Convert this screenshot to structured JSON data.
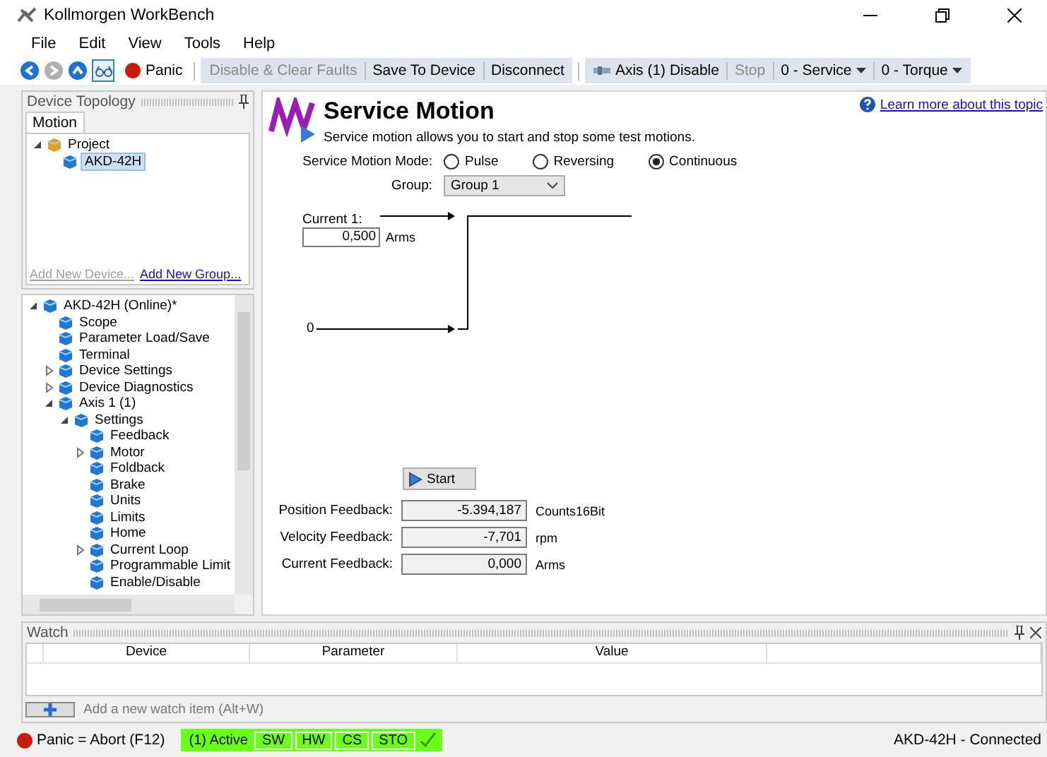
{
  "window": {
    "title": "Kollmorgen WorkBench"
  },
  "menu": [
    "File",
    "Edit",
    "View",
    "Tools",
    "Help"
  ],
  "toolbar": {
    "nav": [
      {
        "kind": "back",
        "disabled": false
      },
      {
        "kind": "forward",
        "disabled": true
      },
      {
        "kind": "up",
        "disabled": false
      }
    ],
    "view_toggle": {
      "selected": true
    },
    "panic": "Panic",
    "buttons": [
      {
        "label": "Disable & Clear Faults",
        "disabled": true
      },
      {
        "label": "Save To Device",
        "disabled": false
      },
      {
        "label": "Disconnect",
        "disabled": false
      }
    ],
    "axis_controls": [
      {
        "kind": "axis",
        "label": "Axis (1) Disable",
        "disabled": false
      },
      {
        "kind": "button",
        "label": "Stop",
        "disabled": true
      },
      {
        "kind": "dropdown",
        "label": "0 - Service",
        "disabled": false
      },
      {
        "kind": "dropdown",
        "label": "0 - Torque",
        "disabled": false
      }
    ]
  },
  "topology": {
    "title": "Device Topology",
    "tabs": [
      {
        "label": "Motion",
        "selected": true
      }
    ],
    "tree": [
      {
        "label": "Project",
        "selected": false,
        "expanded": true,
        "children": [
          {
            "label": "AKD-42H",
            "selected": true
          }
        ]
      }
    ],
    "links": [
      {
        "label": "Add New Device...",
        "disabled": true
      },
      {
        "label": "Add New Group...",
        "disabled": false
      }
    ]
  },
  "device_tree": [
    {
      "label": "AKD-42H (Online)*",
      "expanded": true,
      "children": [
        {
          "label": "Scope"
        },
        {
          "label": "Parameter Load/Save"
        },
        {
          "label": "Terminal"
        },
        {
          "label": "Device Settings",
          "expanded": false
        },
        {
          "label": "Device Diagnostics",
          "expanded": false
        },
        {
          "label": "Axis 1 (1)",
          "expanded": true,
          "children": [
            {
              "label": "Settings",
              "expanded": true,
              "children": [
                {
                  "label": "Feedback"
                },
                {
                  "label": "Motor",
                  "expanded": false
                },
                {
                  "label": "Foldback"
                },
                {
                  "label": "Brake"
                },
                {
                  "label": "Units"
                },
                {
                  "label": "Limits"
                },
                {
                  "label": "Home"
                },
                {
                  "label": "Current Loop",
                  "expanded": false
                },
                {
                  "label": "Programmable Limit"
                },
                {
                  "label": "Enable/Disable"
                }
              ]
            }
          ]
        }
      ]
    }
  ],
  "page": {
    "title": "Service Motion",
    "description": "Service motion allows you to start and stop some test motions.",
    "help_link": "Learn more about this topic",
    "mode_label": "Service Motion Mode:",
    "modes": [
      {
        "label": "Pulse",
        "selected": false
      },
      {
        "label": "Reversing",
        "selected": false
      },
      {
        "label": "Continuous",
        "selected": true
      }
    ],
    "group_label": "Group:",
    "group_value": "Group 1",
    "diagram": {
      "current_label": "Current 1:",
      "current_value": "0,500",
      "current_unit": "Arms",
      "zero_label": "0"
    },
    "start": "Start",
    "feedback": [
      {
        "label": "Position Feedback:",
        "value": "-5.394,187",
        "unit": "Counts16Bit"
      },
      {
        "label": "Velocity Feedback:",
        "value": "-7,701",
        "unit": "rpm"
      },
      {
        "label": "Current Feedback:",
        "value": "0,000",
        "unit": "Arms"
      }
    ]
  },
  "watch": {
    "title": "Watch",
    "columns": [
      "Device",
      "Parameter",
      "Value"
    ],
    "add_placeholder": "Add a new watch item (Alt+W)"
  },
  "status_bar": {
    "panic": "Panic = Abort (F12)",
    "indicators": [
      {
        "kind": "text",
        "label": "(1) Active"
      },
      {
        "kind": "flag",
        "label": "SW"
      },
      {
        "kind": "flag",
        "label": "HW"
      },
      {
        "kind": "flag",
        "label": "CS"
      },
      {
        "kind": "flag",
        "label": "STO"
      }
    ],
    "connection": "AKD-42H - Connected"
  }
}
